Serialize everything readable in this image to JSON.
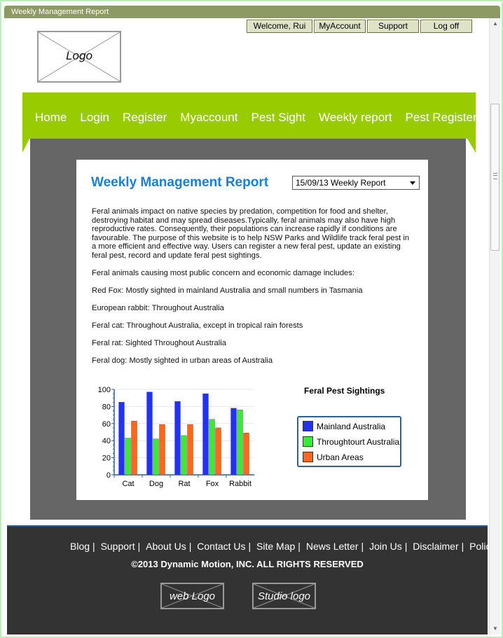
{
  "window": {
    "title": "Weekly Management Report"
  },
  "userbar": {
    "welcome": "Welcome, Rui",
    "myaccount": "MyAccount",
    "support": "Support",
    "logoff": "Log off"
  },
  "logo": {
    "label": "Logo"
  },
  "nav": {
    "items": [
      "Home",
      "Login",
      "Register",
      "Myaccount",
      "Pest Sight",
      "Weekly report",
      "Pest Register"
    ]
  },
  "report": {
    "title": "Weekly Management Report",
    "selected_report": "15/09/13 Weekly Report",
    "intro": "Feral animals impact on native species by predation, competition for food and shelter, destroying habitat and may spread diseases.Typically, feral animals may also have high reproductive rates. Consequently, their populations can increase rapidly if conditions are favourable. The purpose of this website is to help NSW Parks and Wildlife track feral pest in a more efficient and effective way. Users can register a new feral pest, update an existing feral pest, record and update feral pest sightings.",
    "concern": "Feral animals causing most public concern and economic damage includes:",
    "animals": [
      "Red Fox: Mostly sighted in mainland Australia and small numbers in Tasmania",
      "European rabbit: Throughout Australia",
      "Feral cat: Throughout Australia, except in tropical rain forests",
      "Feral rat: Sighted Throughout Australia",
      "Feral dog: Mostly sighted in urban areas of Australia"
    ]
  },
  "chart_data": {
    "type": "bar",
    "title": "Feral Pest Sightings",
    "categories": [
      "Cat",
      "Dog",
      "Rat",
      "Fox",
      "Rabbit"
    ],
    "series": [
      {
        "name": "Mainland Australia",
        "color": "#2233ee",
        "values": [
          85,
          97,
          86,
          95,
          78
        ]
      },
      {
        "name": "Throughtourt Australia",
        "color": "#33ee33",
        "values": [
          43,
          42,
          46,
          65,
          76
        ]
      },
      {
        "name": "Urban Areas",
        "color": "#ff6622",
        "values": [
          63,
          59,
          59,
          55,
          49
        ]
      }
    ],
    "ylim": [
      0,
      100
    ],
    "yticks": [
      0,
      20,
      40,
      60,
      80,
      100
    ],
    "legend": "right",
    "grid": true
  },
  "footer": {
    "links": [
      "Blog",
      "Support",
      "About Us",
      "Contact Us",
      "Site Map",
      "News Letter",
      "Join Us",
      "Disclaimer",
      "Policies"
    ],
    "copyright": "©2013 Dynamic Motion, INC. ALL RIGHTS RESERVED",
    "web_logo": "web Logo",
    "studio_logo": "Studio logo"
  }
}
